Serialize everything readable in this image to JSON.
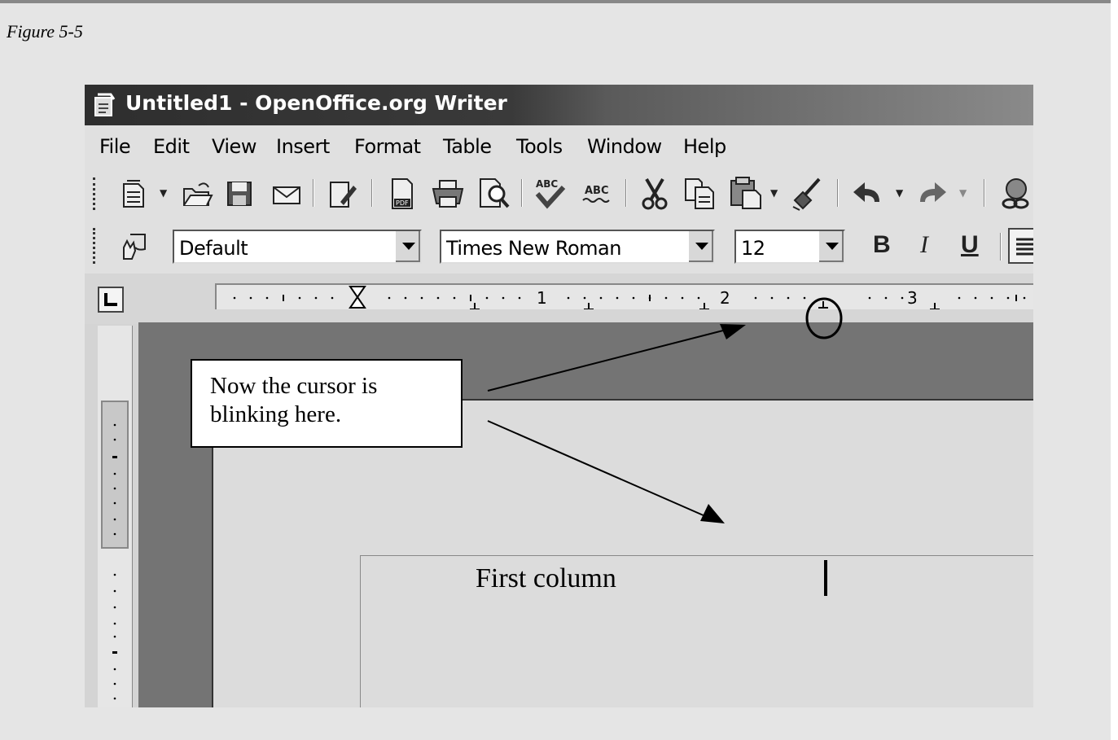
{
  "caption": "Figure 5-5",
  "window": {
    "title": "Untitled1 - OpenOffice.org Writer"
  },
  "menu": {
    "items": [
      "File",
      "Edit",
      "View",
      "Insert",
      "Format",
      "Table",
      "Tools",
      "Window",
      "Help"
    ]
  },
  "format_toolbar": {
    "style_value": "Default",
    "font_value": "Times New Roman",
    "size_value": "12",
    "bold": "B",
    "italic": "I",
    "underline": "U"
  },
  "ruler": {
    "labels": [
      "1",
      "2",
      "3"
    ]
  },
  "document": {
    "text": "First column"
  },
  "callout": {
    "line1": "Now the cursor is",
    "line2": "blinking here."
  }
}
